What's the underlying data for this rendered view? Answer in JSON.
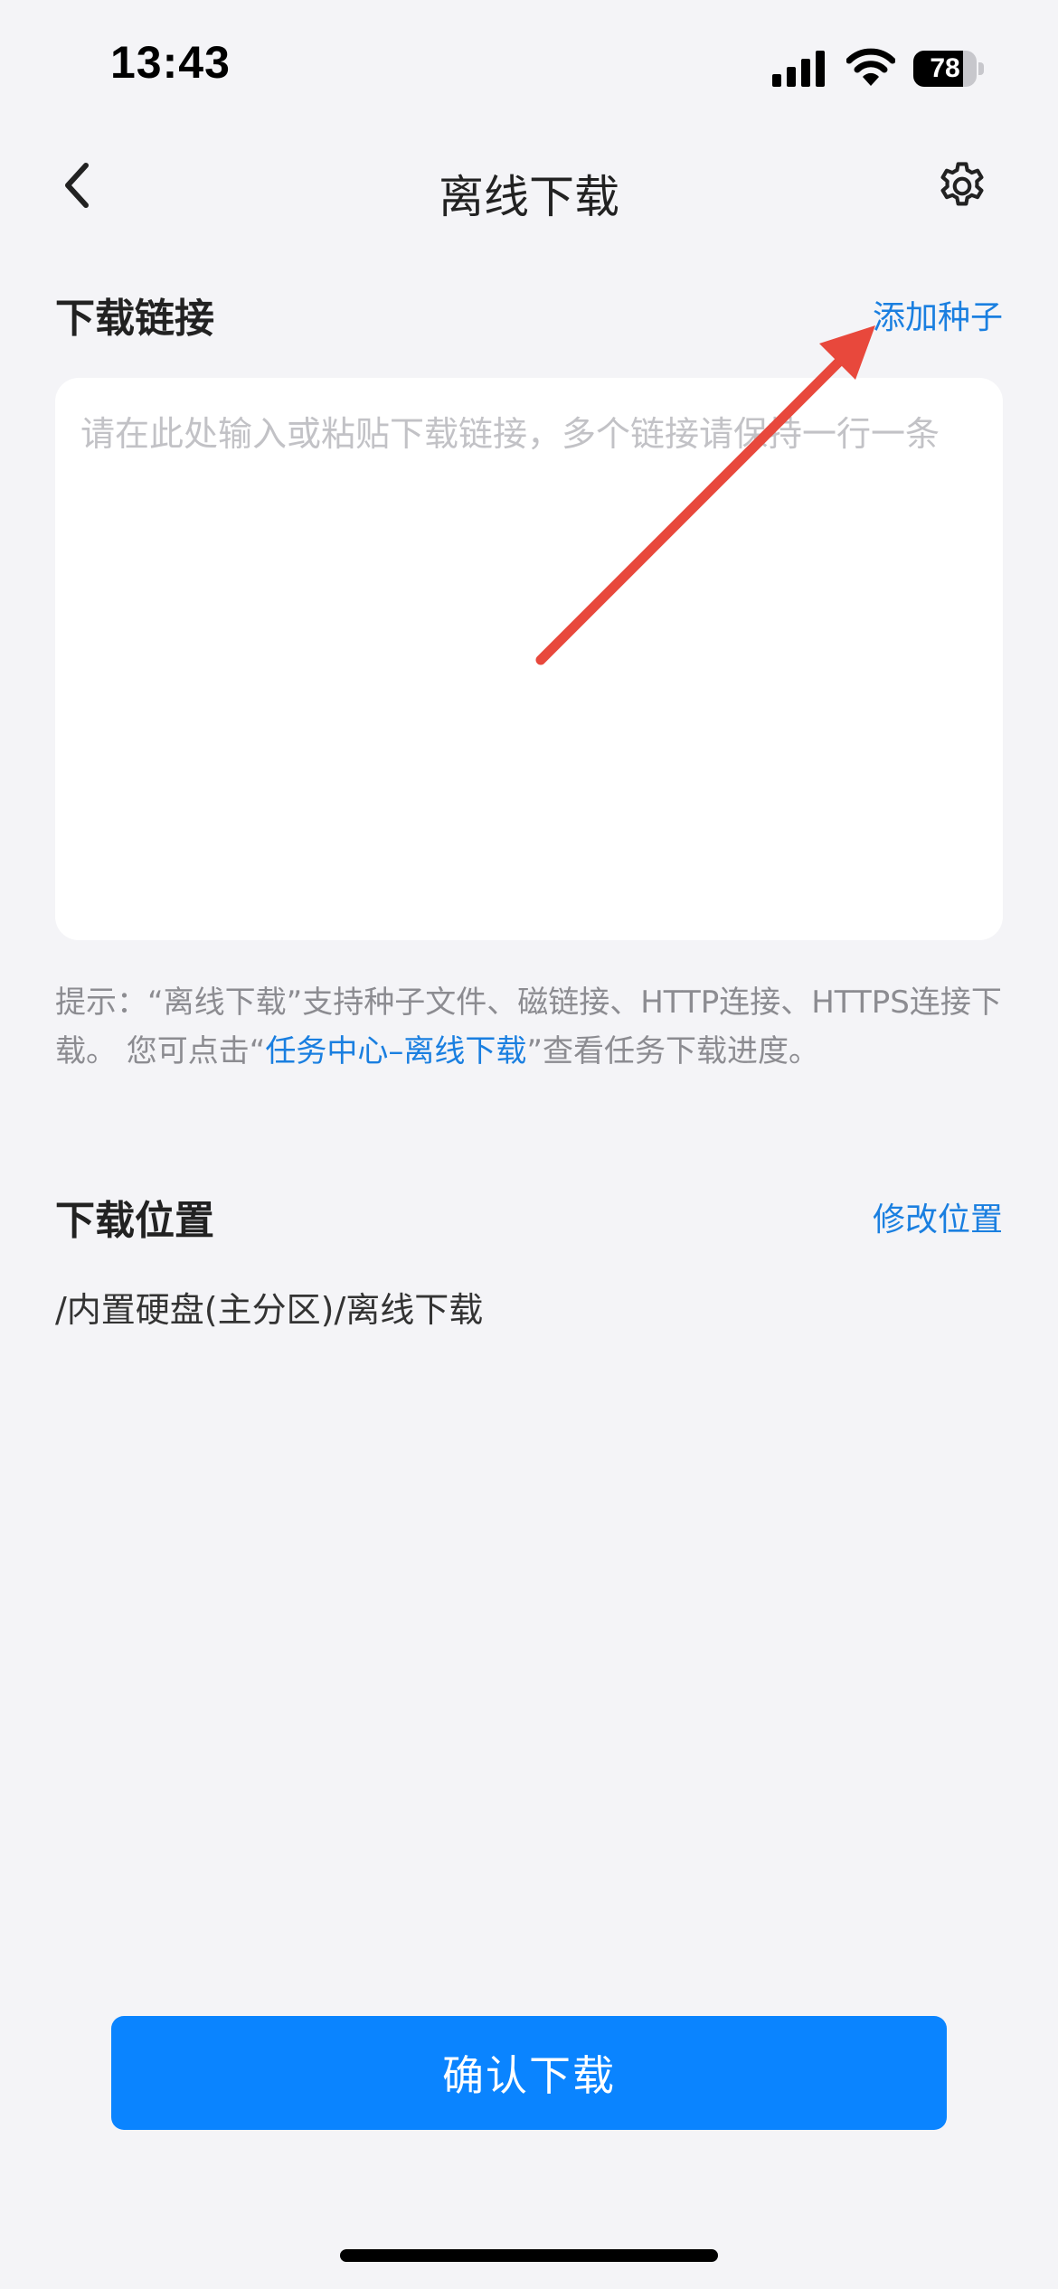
{
  "status_bar": {
    "time": "13:43",
    "battery_level": "78",
    "battery_fraction": 0.78,
    "icons": [
      "signal-icon",
      "wifi-icon",
      "battery-icon"
    ]
  },
  "nav": {
    "title": "离线下载",
    "back_icon": "chevron-left-icon",
    "settings_icon": "gear-icon"
  },
  "download_link": {
    "title": "下载链接",
    "add_torrent_label": "添加种子",
    "input_value": "",
    "input_placeholder": "请在此处输入或粘贴下载链接，多个链接请保持一行一条"
  },
  "hint": {
    "prefix": "提示：“离线下载”支持种子文件、磁链接、HTTP连接、HTTPS连接下载。 您可点击“",
    "link": "任务中心–离线下载",
    "suffix": "”查看任务下载进度。"
  },
  "download_location": {
    "title": "下载位置",
    "change_label": "修改位置",
    "path": "/内置硬盘(主分区)/离线下载"
  },
  "confirm_button_label": "确认下载",
  "colors": {
    "accent": "#0a84ff",
    "link": "#1a7fe0",
    "background": "#f4f4f7",
    "annotation_arrow": "#e8483c"
  }
}
